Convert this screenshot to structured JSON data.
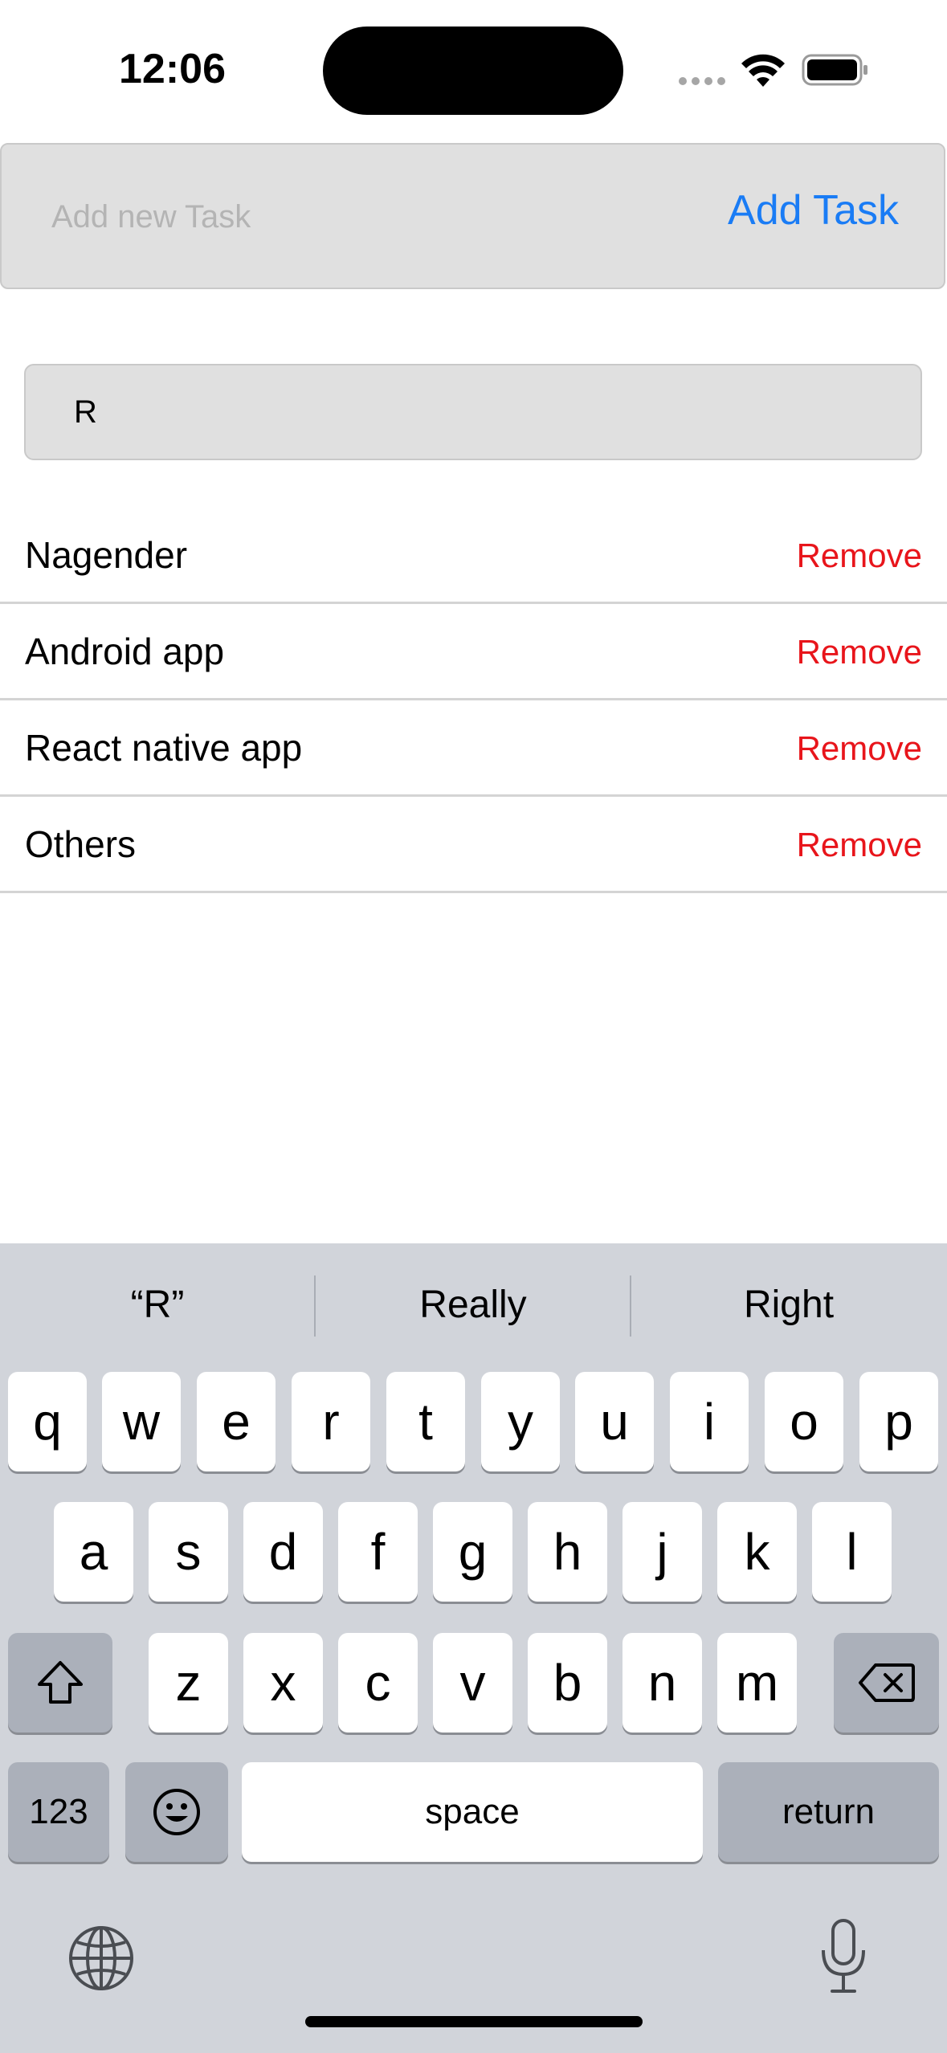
{
  "status_bar": {
    "time": "12:06"
  },
  "add_task": {
    "placeholder": "Add new Task",
    "value": "",
    "button_label": "Add Task"
  },
  "search": {
    "value": "R",
    "placeholder": ""
  },
  "tasks": [
    {
      "name": "Nagender",
      "action": "Remove"
    },
    {
      "name": "Android app",
      "action": "Remove"
    },
    {
      "name": "React native app",
      "action": "Remove"
    },
    {
      "name": "Others",
      "action": "Remove"
    }
  ],
  "keyboard": {
    "suggestions": [
      "“R”",
      "Really",
      "Right"
    ],
    "row1": [
      "q",
      "w",
      "e",
      "r",
      "t",
      "y",
      "u",
      "i",
      "o",
      "p"
    ],
    "row2": [
      "a",
      "s",
      "d",
      "f",
      "g",
      "h",
      "j",
      "k",
      "l"
    ],
    "row3": [
      "z",
      "x",
      "c",
      "v",
      "b",
      "n",
      "m"
    ],
    "numbers_label": "123",
    "space_label": "space",
    "return_label": "return"
  },
  "colors": {
    "accent": "#1a7cf5",
    "destructive": "#e8151b",
    "field_background": "#e0e0e0",
    "keyboard_background": "#d1d4da"
  },
  "icons": [
    "wifi-icon",
    "battery-icon",
    "shift-icon",
    "delete-icon",
    "emoji-icon",
    "globe-icon",
    "microphone-icon"
  ]
}
